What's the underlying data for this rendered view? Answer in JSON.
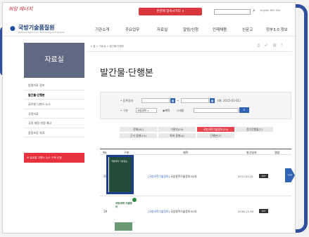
{
  "top": {
    "slogan": "희망 에너지",
    "red_button": "본관에 접속시키다 ∨",
    "search_icon": "search-icon",
    "links": "English  RSS  Site"
  },
  "header": {
    "org_name": "국방기술품질원",
    "org_sub": "Defense Agency for Technology and Quality",
    "nav": [
      "기관소개",
      "주요업무",
      "자료실",
      "알림/신청",
      "인재채용",
      "신문고",
      "정부3.0 정보"
    ]
  },
  "breadcrumb": "⌂  홈 > 자료실 > 발간물·단행본",
  "sidebar": {
    "title": "자료실",
    "items": [
      "법령자료 정보",
      "발간물·단행본",
      "글로벌 디펜스 뉴스",
      "규정자료",
      "규정 제정·개정 예고",
      "품질보증 자료"
    ],
    "active_index": 1,
    "banner": "글로벌 디펜스 뉴스 구독 신청"
  },
  "content": {
    "title": "발간물·단행본",
    "search": {
      "date_label": "• 등록일자",
      "date_hint": "(예: 2015-01-01)",
      "type_label": "• 구분",
      "type_value": "국방과학 ∨",
      "radio_title": "◉제목",
      "radio_content": "○내용",
      "search_btn_icon": "search-icon"
    },
    "tabs": [
      {
        "label": "전체(61)",
        "active": false
      },
      {
        "label": "기관지(10)",
        "active": false
      },
      {
        "label": "국방과학기술정보(20)",
        "active": true
      },
      {
        "label": "정기간행물(7)",
        "active": false
      },
      {
        "label": "군사 동향(13)",
        "active": false
      },
      {
        "label": "특허 동향(4)",
        "active": false
      },
      {
        "label": "단행본(7)",
        "active": false
      }
    ],
    "table": {
      "headers": [
        "No.",
        "구분",
        "제목",
        "발간일자",
        "열람"
      ],
      "rows": [
        {
          "no": "20",
          "category": "[국방과학기술정보]",
          "title": "국방과학기술정보 62호",
          "date": "2017-02-01",
          "view": "PDF",
          "thumb_title": "국방과학\n기술정보"
        },
        {
          "no": "19",
          "category": "[국방과학기술정보]",
          "title": "국방과학기술정보 61호",
          "date": "2016-11-30",
          "view": "PDF",
          "thumb_title": "국방과학\n기술정보"
        }
      ]
    }
  },
  "top_button": "TOP",
  "colors": {
    "accent_blue": "#2f63b6",
    "accent_red": "#e94250",
    "sidebar_bg": "#5f6a80",
    "frame_blue": "#1b3f8f"
  }
}
